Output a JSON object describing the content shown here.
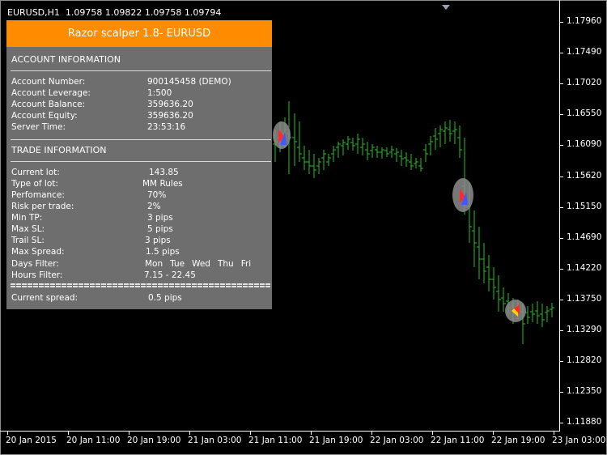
{
  "chart": {
    "header": "EURUSD,H1  1.09758 1.09822 1.09758 1.09794",
    "candle_color": "#22c322",
    "price_labels": [
      "1.17960",
      "1.17490",
      "1.17020",
      "1.16550",
      "1.16090",
      "1.15620",
      "1.15150",
      "1.14690",
      "1.14220",
      "1.13750",
      "1.13290",
      "1.12820",
      "1.12350",
      "1.11880"
    ],
    "time_labels": [
      "20 Jan 2015",
      "20 Jan 11:00",
      "20 Jan 19:00",
      "21 Jan 03:00",
      "21 Jan 11:00",
      "21 Jan 19:00",
      "22 Jan 03:00",
      "22 Jan 11:00",
      "22 Jan 19:00",
      "23 Jan 03:00"
    ]
  },
  "panel": {
    "title": "Razor scalper 1.8- EURUSD",
    "title_color": "#ff8c00",
    "background": "#6e6e6e",
    "account_section": "ACCOUNT INFORMATION",
    "account_rows": [
      {
        "label": "Account Number:",
        "value": "900145458 (DEMO)"
      },
      {
        "label": "Account Leverage:",
        "value": "1:500"
      },
      {
        "label": "Account Balance:",
        "value": "359636.20"
      },
      {
        "label": "Account Equity:",
        "value": "359636.20"
      },
      {
        "label": "Server Time:",
        "value": "23:53:16"
      }
    ],
    "trade_section": "TRADE INFORMATION",
    "trade_rows": [
      {
        "label": "Current lot:",
        "value": "143.85"
      },
      {
        "label": "Type of lot:",
        "value": "MM Rules"
      },
      {
        "label": "Perfomance:",
        "value": "70%"
      },
      {
        "label": "Risk per trade:",
        "value": "2%"
      },
      {
        "label": "Min TP:",
        "value": "3 pips"
      },
      {
        "label": "Max SL:",
        "value": "5 pips"
      },
      {
        "label": "Trail SL:",
        "value": "3 pips"
      },
      {
        "label": "Max Spread:",
        "value": "1.5 pips"
      }
    ],
    "days_filter_label": "Days Filter:",
    "days": [
      "Mon",
      "Tue",
      "Wed",
      "Thu",
      "Fri"
    ],
    "hours_filter_label": "Hours Filter:",
    "hours_filter_value": "7.15 - 22.45",
    "spread_label": "Current spread:",
    "spread_value": "0.5 pips"
  }
}
